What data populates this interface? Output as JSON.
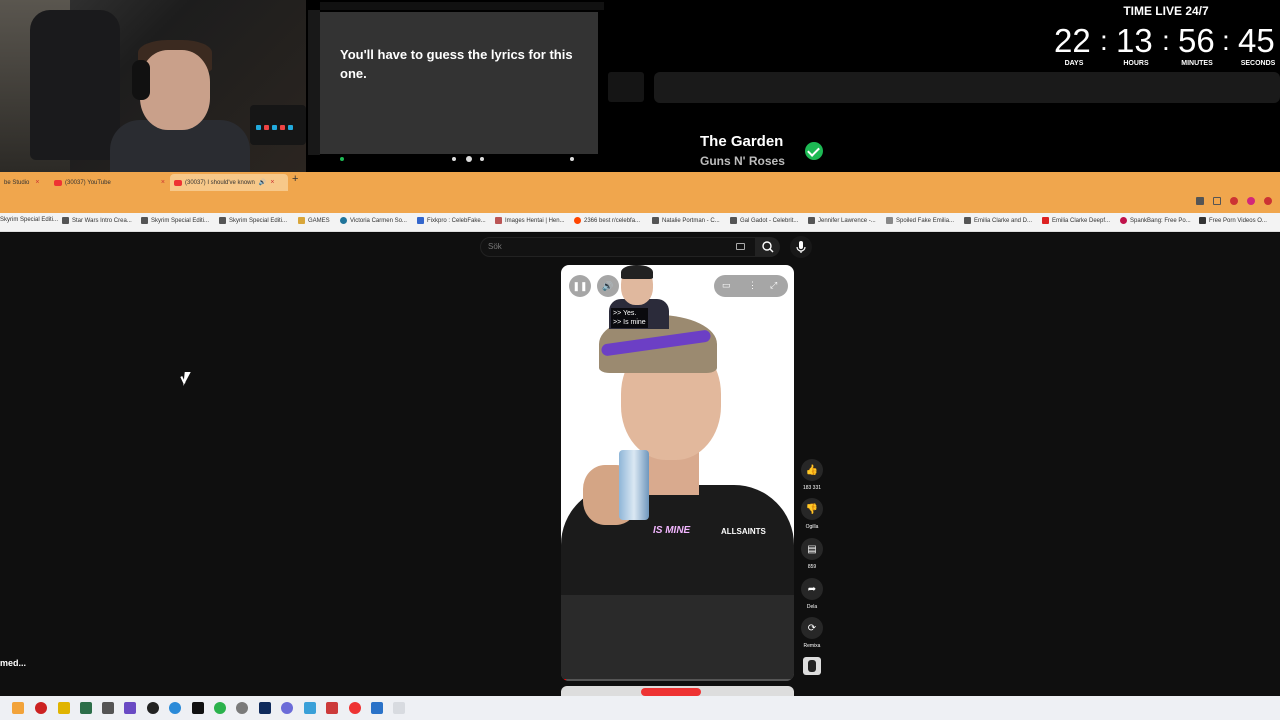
{
  "stream_overlay": {
    "lyrics_caption": "You'll have to guess the lyrics for this one.",
    "song": {
      "title": "The Garden",
      "artist": "Guns N' Roses",
      "status": "check-icon"
    },
    "timer": {
      "title": "TIME LIVE 24/7",
      "days": "22",
      "hours": "13",
      "minutes": "56",
      "seconds": "45",
      "separator": ":",
      "days_label": "DAYS",
      "hours_label": "HOURS",
      "minutes_label": "MINUTES",
      "seconds_label": "SECONDS"
    }
  },
  "browser": {
    "tabs": [
      {
        "label": "be Studio",
        "close": "×"
      },
      {
        "label": "(30037) YouTube",
        "close": "×"
      },
      {
        "label": "(30037) I should've known",
        "close": "×"
      }
    ],
    "new_tab": "+",
    "bookmarks": [
      "Skyrim Special Editi...",
      "Star Wars Intro Crea...",
      "Skyrim Special Editi...",
      "Skyrim Special Editi...",
      "GAMES",
      "Victoria Carmen So...",
      "Fixkpro : CelebFake...",
      "Images Hentai | Hen...",
      "2366 best r/celebfa...",
      "Natalie Portman - C...",
      "Gal Gadot - Celebrit...",
      "Jennifer Lawrence -...",
      "Spoiled Fake Emilia...",
      "Emilia Clarke and D...",
      "Emilia Clarke Deepf...",
      "SpankBang: Free Po...",
      "Free Porn Videos O..."
    ]
  },
  "youtube": {
    "search_placeholder": "Sök",
    "short": {
      "caption_small_line1": ">> Yes.",
      "caption_small_line2": ">> Is mine",
      "caption_big": "IS MINE",
      "shirt_brand": "ALLSAINTS",
      "progress": 0.02
    },
    "actions": [
      {
        "icon": "thumbs-up-icon",
        "label": "183 331"
      },
      {
        "icon": "thumbs-down-icon",
        "label": "Ogilla"
      },
      {
        "icon": "comment-icon",
        "label": "859"
      },
      {
        "icon": "share-icon",
        "label": "Dela"
      },
      {
        "icon": "remix-icon",
        "label": "Remixa"
      }
    ]
  },
  "toast_text": "med..."
}
